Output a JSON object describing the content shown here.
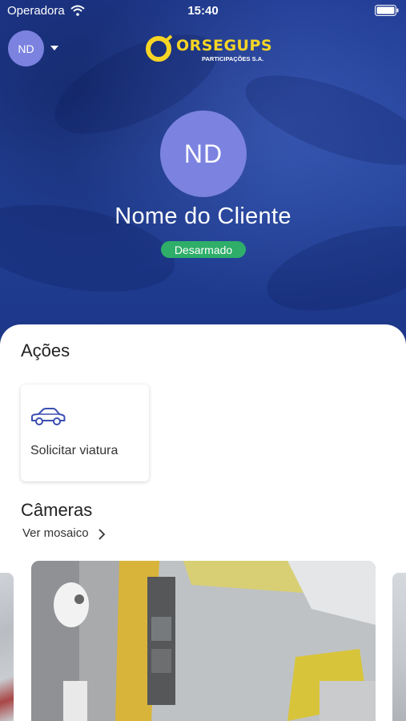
{
  "status_bar": {
    "carrier": "Operadora",
    "time": "15:40",
    "icons": [
      "wifi-icon",
      "battery-icon"
    ]
  },
  "header": {
    "user_initials": "ND",
    "menu_icon": "caret-down-icon",
    "logo": {
      "name": "ORSEGUPS",
      "subtitle": "PARTICIPAÇÕES S.A."
    }
  },
  "profile": {
    "initials": "ND",
    "name": "Nome do Cliente",
    "status": "Desarmado"
  },
  "actions": {
    "title": "Ações",
    "items": [
      {
        "icon": "car-icon",
        "label": "Solicitar viatura"
      }
    ]
  },
  "cameras": {
    "title": "Câmeras",
    "mosaic_link": "Ver mosaico",
    "link_icon": "chevron-right-icon"
  },
  "colors": {
    "header_bg": "#24449c",
    "avatar": "#7b82e0",
    "logo_accent": "#f7d524",
    "status_disarmed": "#2eae69",
    "action_icon": "#3c4fb0"
  }
}
